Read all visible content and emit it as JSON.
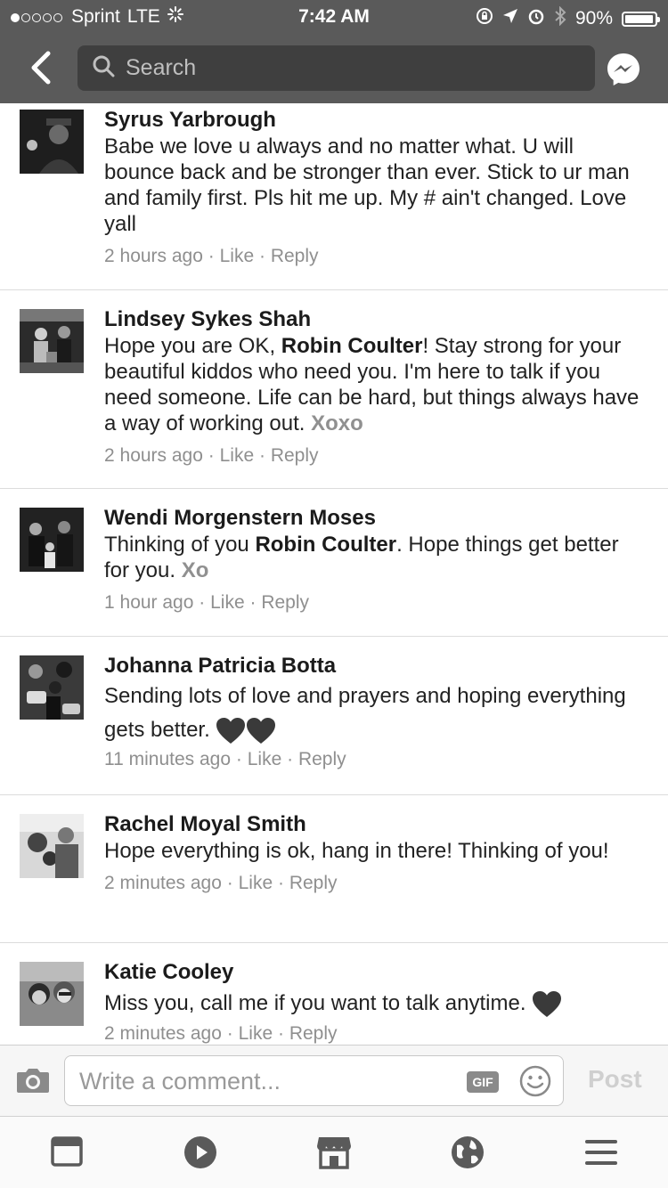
{
  "status_bar": {
    "carrier": "Sprint",
    "network": "LTE",
    "time": "7:42 AM",
    "battery": "90%",
    "battery_level": 0.9,
    "signal_bars_filled": 1,
    "signal_bars_total": 5
  },
  "nav": {
    "search_placeholder": "Search"
  },
  "comments": [
    {
      "author": "Syrus Yarbrough",
      "text": "Babe we love u always and no matter what. U will bounce back and be stronger than ever. Stick to ur man and family first. Pls hit me up. My # ain't changed. Love yall",
      "time": "2 hours ago",
      "like": "Like",
      "reply": "Reply"
    },
    {
      "author": "Lindsey Sykes Shah",
      "text_before": "Hope you are OK, ",
      "mention": "Robin Coulter",
      "text_after": "! Stay strong for your beautiful kiddos who need you. I'm here to talk if you need someone. Life can be hard, but things always have a way of working out. ",
      "signoff": "Xoxo",
      "time": "2 hours ago",
      "like": "Like",
      "reply": "Reply"
    },
    {
      "author": "Wendi Morgenstern Moses",
      "text_before": "Thinking of you ",
      "mention": "Robin Coulter",
      "text_after": ". Hope things get better for you. ",
      "signoff": "Xo",
      "time": "1 hour ago",
      "like": "Like",
      "reply": "Reply"
    },
    {
      "author": "Johanna Patricia Botta",
      "text": "Sending lots of love and prayers and hoping everything gets better.",
      "time": "11 minutes ago",
      "like": "Like",
      "reply": "Reply"
    },
    {
      "author": "Rachel Moyal Smith",
      "text": "Hope everything is ok, hang in there! Thinking of you!",
      "time": "2 minutes ago",
      "like": "Like",
      "reply": "Reply"
    },
    {
      "author": "Katie Cooley",
      "text": "Miss you, call me if you want to talk anytime.",
      "time": "2 minutes ago",
      "like": "Like",
      "reply": "Reply"
    }
  ],
  "separator": "·",
  "composer": {
    "placeholder": "Write a comment...",
    "gif_label": "GIF",
    "post_label": "Post"
  },
  "icons": {
    "status": [
      "lock-rotation-icon",
      "location-arrow-icon",
      "alarm-icon",
      "bluetooth-icon"
    ],
    "nav": [
      "back-chevron-icon",
      "search-icon",
      "messenger-icon"
    ],
    "composer": [
      "camera-icon",
      "smiley-icon"
    ],
    "tabs": [
      "news-feed-icon",
      "video-play-icon",
      "marketplace-icon",
      "globe-icon",
      "menu-icon"
    ]
  },
  "colors": {
    "header_bg": "#5a5a5a",
    "search_bg": "#3f3f3f",
    "heart": "#3a3a3a"
  }
}
